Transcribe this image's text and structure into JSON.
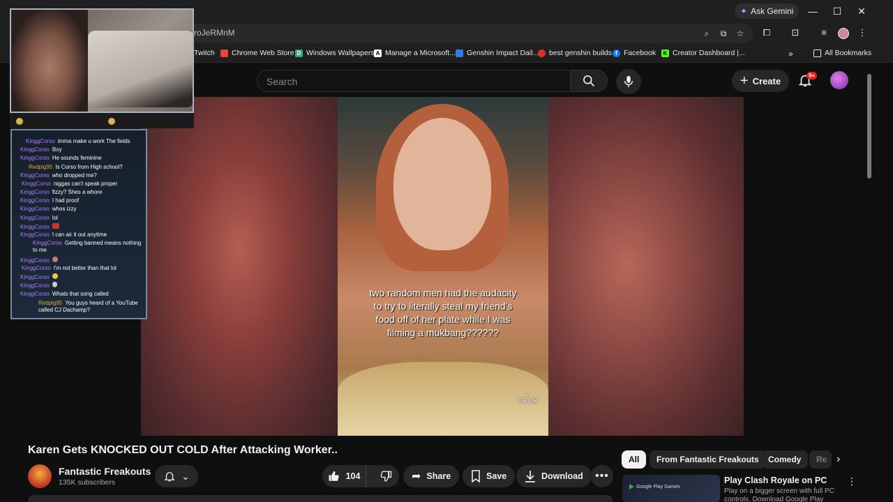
{
  "browser": {
    "gemini_label": "Ask Gemini",
    "url_fragment": "roJeRMnM",
    "bookmarks": [
      {
        "label": "Twitch",
        "icon": "twitch-icon"
      },
      {
        "label": "Chrome Web Store",
        "icon": "chrome-web-store-icon"
      },
      {
        "label": "Windows Wallpapers",
        "icon": "wallpapers-icon"
      },
      {
        "label": "Manage a Microsoft...",
        "icon": "microsoft-icon"
      },
      {
        "label": "Genshin Impact Dail...",
        "icon": "genshin-icon"
      },
      {
        "label": "best genshin builds",
        "icon": "builds-icon"
      },
      {
        "label": "Facebook",
        "icon": "facebook-icon"
      },
      {
        "label": "Creator Dashboard |...",
        "icon": "kick-icon"
      },
      {
        "label": "All Bookmarks",
        "icon": "folder-icon"
      }
    ]
  },
  "header": {
    "search_placeholder": "Search",
    "create_label": "Create",
    "notif_count": "9+"
  },
  "video": {
    "caption": "two random men had the audacity to try to literally steal my friend's food off of her plate while I was filming a mukbang??????",
    "watermark": "TikTok"
  },
  "chat": [
    {
      "user": "KinggCorso",
      "msg": "imma make u work The fields",
      "color": "#b07cff"
    },
    {
      "user": "KinggCorso",
      "msg": "Boy",
      "color": "#b07cff"
    },
    {
      "user": "KinggCorso",
      "msg": "He sounds feminine",
      "color": "#b07cff"
    },
    {
      "user": "Redpig95",
      "msg": "Is Corso from High school?",
      "color": "#e8a33c"
    },
    {
      "user": "KinggCorso",
      "msg": "who dropped me?",
      "color": "#b07cff"
    },
    {
      "user": "KinggCorso",
      "msg": "niggas can't speak proper",
      "color": "#b07cff"
    },
    {
      "user": "KinggCorso",
      "msg": "fizzy? Shes a whore",
      "color": "#b07cff"
    },
    {
      "user": "KinggCorso",
      "msg": "I had proof",
      "color": "#b07cff"
    },
    {
      "user": "KinggCorso",
      "msg": "whos izzy",
      "color": "#b07cff"
    },
    {
      "user": "KinggCorso",
      "msg": "lol",
      "color": "#b07cff"
    },
    {
      "user": "KinggCorso",
      "msg": "",
      "color": "#b07cff"
    },
    {
      "user": "KinggCorso",
      "msg": "I can air it out anytime",
      "color": "#b07cff"
    },
    {
      "user": "KinggCorso",
      "msg": "Getting banned means nothing to me",
      "color": "#b07cff"
    },
    {
      "user": "KinggCorso",
      "msg": "",
      "color": "#b07cff"
    },
    {
      "user": "KinggCorso",
      "msg": "I'm not better than that lol",
      "color": "#b07cff"
    },
    {
      "user": "KinggCorso",
      "msg": "",
      "color": "#b07cff"
    },
    {
      "user": "KinggCorso",
      "msg": "",
      "color": "#b07cff"
    },
    {
      "user": "KinggCorso",
      "msg": "Whats that song called",
      "color": "#b07cff"
    },
    {
      "user": "Redpig95",
      "msg": "You guys heard of a YouTube called CJ Dachamp?",
      "color": "#e8a33c"
    }
  ],
  "meta": {
    "title": "Karen Gets KNOCKED OUT COLD After Attacking Worker..",
    "channel": "Fantastic Freakouts",
    "subscribers": "135K subscribers",
    "likes": "104",
    "share": "Share",
    "save": "Save",
    "download": "Download"
  },
  "chips": [
    "All",
    "From Fantastic Freakouts",
    "Comedy",
    "Re"
  ],
  "recommendation": {
    "thumb_label": "Google Play Games",
    "title": "Play Clash Royale on PC",
    "desc": "Play on a bigger screen with full PC controls. Download Google Play"
  }
}
